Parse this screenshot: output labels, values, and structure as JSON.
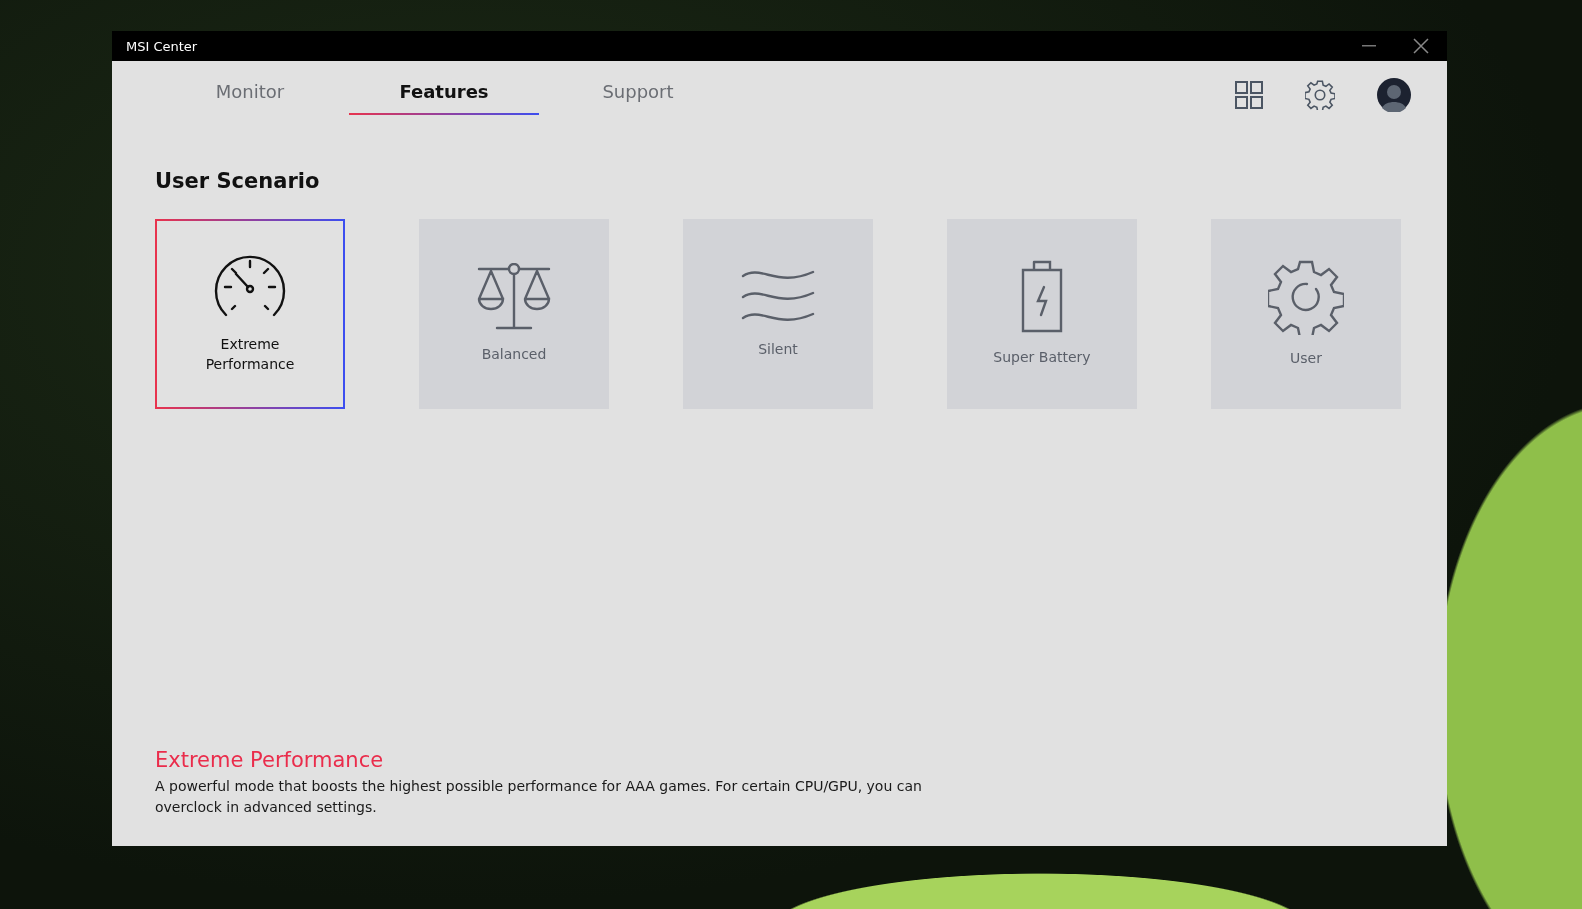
{
  "window": {
    "title": "MSI Center"
  },
  "tabs": [
    {
      "label": "Monitor",
      "selected": false
    },
    {
      "label": "Features",
      "selected": true
    },
    {
      "label": "Support",
      "selected": false
    }
  ],
  "section_title": "User Scenario",
  "scenarios": [
    {
      "label": "Extreme Performance",
      "kind": "gauge",
      "selected": true
    },
    {
      "label": "Balanced",
      "kind": "scale",
      "selected": false
    },
    {
      "label": "Silent",
      "kind": "waves",
      "selected": false
    },
    {
      "label": "Super Battery",
      "kind": "battery",
      "selected": false
    },
    {
      "label": "User",
      "kind": "gear",
      "selected": false
    }
  ],
  "description": {
    "title": "Extreme Performance",
    "text": "A powerful mode that boosts the highest possible performance for AAA games. For certain CPU/GPU, you can overclock in advanced settings."
  }
}
